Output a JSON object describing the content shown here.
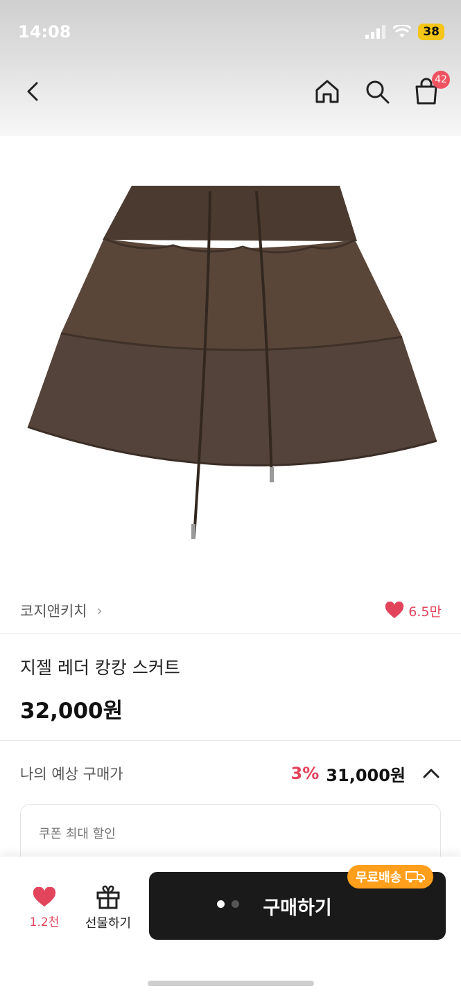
{
  "status_bar": {
    "time": "14:08",
    "battery": "38"
  },
  "nav": {
    "cart_badge": "42"
  },
  "colors": {
    "accent": "#e2445c",
    "buy_button": "#1a1a1a",
    "free_shipping": "#ff9f1c",
    "skirt": "#5a4639"
  },
  "product": {
    "brand": "코지앤키치",
    "likes": "6.5만",
    "name": "지젤 레더 캉캉 스커트",
    "price": "32,000원"
  },
  "expected_price": {
    "label": "나의 예상 구매가",
    "discount": "3%",
    "price": "31,000원"
  },
  "coupon": {
    "label": "쿠폰 최대 할인"
  },
  "bottom_bar": {
    "wish_count": "1.2천",
    "gift_label": "선물하기",
    "buy_label": "구매하기",
    "free_shipping_label": "무료배송",
    "carousel_dots": 2,
    "active_dot": 1
  }
}
